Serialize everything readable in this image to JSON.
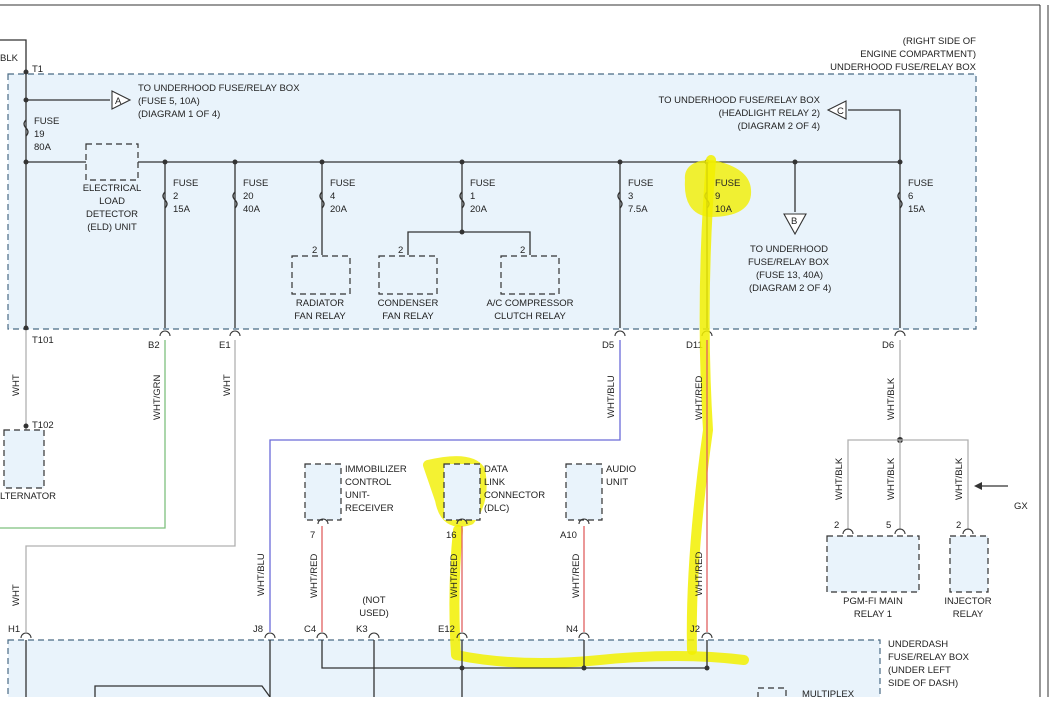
{
  "diagram": {
    "top_right_header": [
      "(RIGHT SIDE OF",
      "ENGINE COMPARTMENT)",
      "UNDERHOOD FUSE/RELAY BOX"
    ],
    "underdash_header": [
      "UNDERDASH",
      "FUSE/RELAY BOX",
      "(UNDER LEFT",
      "SIDE OF DASH)"
    ],
    "connector_labels": {
      "blk": "BLK",
      "t1": "T1",
      "t101": "T101",
      "t102": "T102",
      "b2": "B2",
      "e1": "E1",
      "d5": "D5",
      "d11": "D11",
      "d6": "D6",
      "h1": "H1",
      "j8": "J8",
      "c4": "C4",
      "k3": "K3",
      "e12": "E12",
      "n4": "N4",
      "j2": "J2",
      "pin7": "7",
      "pin16": "16",
      "pinA10": "A10",
      "pin2a": "2",
      "pin5": "5",
      "pin2b": "2",
      "rad2": "2",
      "cond2": "2",
      "ac2": "2"
    },
    "arrow_a": {
      "letter": "A",
      "text": [
        "TO UNDERHOOD FUSE/RELAY BOX",
        "(FUSE 5, 10A)",
        "(DIAGRAM 1 OF 4)"
      ]
    },
    "arrow_b": {
      "letter": "B",
      "text": [
        "TO UNDERHOOD",
        "FUSE/RELAY BOX",
        "(FUSE 13, 40A)",
        "(DIAGRAM 2 OF 4)"
      ]
    },
    "arrow_c": {
      "letter": "C",
      "text": [
        "TO UNDERHOOD FUSE/RELAY BOX",
        "(HEADLIGHT RELAY 2)",
        "(DIAGRAM 2 OF 4)"
      ]
    },
    "fuses": {
      "f19": [
        "FUSE",
        "19",
        "80A"
      ],
      "f2": [
        "FUSE",
        "2",
        "15A"
      ],
      "f20": [
        "FUSE",
        "20",
        "40A"
      ],
      "f4": [
        "FUSE",
        "4",
        "20A"
      ],
      "f1": [
        "FUSE",
        "1",
        "20A"
      ],
      "f3": [
        "FUSE",
        "3",
        "7.5A"
      ],
      "f9": [
        "FUSE",
        "9",
        "10A"
      ],
      "f6": [
        "FUSE",
        "6",
        "15A"
      ]
    },
    "components": {
      "eld": [
        "ELECTRICAL",
        "LOAD",
        "DETECTOR",
        "(ELD) UNIT"
      ],
      "radiator": [
        "RADIATOR",
        "FAN RELAY"
      ],
      "condenser": [
        "CONDENSER",
        "FAN RELAY"
      ],
      "ac": [
        "A/C COMPRESSOR",
        "CLUTCH RELAY"
      ],
      "alternator": "LTERNATOR",
      "immobilizer": [
        "IMMOBILIZER",
        "CONTROL",
        "UNIT-",
        "RECEIVER"
      ],
      "dlc": [
        "DATA",
        "LINK",
        "CONNECTOR",
        "(DLC)"
      ],
      "audio": [
        "AUDIO",
        "UNIT"
      ],
      "pgm": [
        "PGM-FI MAIN",
        "RELAY 1"
      ],
      "injector": [
        "INJECTOR",
        "RELAY"
      ],
      "not_used": [
        "(NOT",
        "USED)"
      ],
      "multiplex": "MULTIPLEX",
      "gx": "GX"
    },
    "wire_colors": {
      "wht": "WHT",
      "whtgrn": "WHT/GRN",
      "whtblu": "WHT/BLU",
      "whtred": "WHT/RED",
      "whtblk": "WHT/BLK"
    },
    "colors": {
      "box_fill": "#e9f3fb",
      "highlight": "#f2f000",
      "wire_red": "#e06060",
      "wire_blue": "#6a6ad8",
      "wire_green": "#7ec07e",
      "wire_gray": "#b0b0b0"
    }
  }
}
